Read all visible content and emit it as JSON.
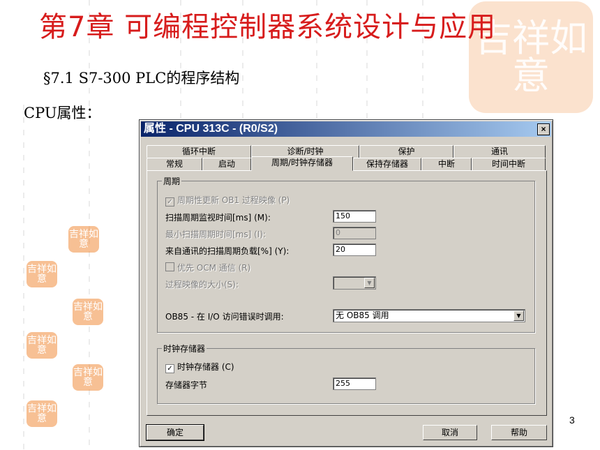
{
  "slide": {
    "title": "第7章 可编程控制器系统设计与应用",
    "section": "§7.1 S7-300 PLC的程序结构",
    "cpu_label": "CPU属性：",
    "page_number": "3",
    "seal_text_big": "吉祥如意",
    "seal_text_small": "吉祥如意"
  },
  "dialog": {
    "title": "属性 - CPU 313C - (R0/S2)",
    "close_glyph": "×",
    "tabs_row_back": [
      "循环中断",
      "诊断/时钟",
      "保护",
      "通讯"
    ],
    "tabs_row_front": [
      "常规",
      "启动",
      "周期/时钟存储器",
      "保持存储器",
      "中断",
      "时间中断"
    ],
    "active_tab": "周期/时钟存储器",
    "cycle_group": {
      "legend": "周期",
      "periodic_update_label": "周期性更新 OB1 过程映像 (P)",
      "periodic_update_checked": "✓",
      "scan_monitor_label": "扫描周期监视时间[ms] (M):",
      "scan_monitor_value": "150",
      "min_scan_label": "最小扫描周期时间[ms] (I):",
      "min_scan_value": "0",
      "comm_load_label": "来自通讯的扫描周期负载[%] (Y):",
      "comm_load_value": "20",
      "prio_ocm_label": "优先 OCM 通信 (R)",
      "process_image_label": "过程映像的大小(S):",
      "process_image_value": "",
      "ob85_label": "OB85 - 在 I/O 访问错误时调用:",
      "ob85_value": "无 OB85 调用"
    },
    "clock_group": {
      "legend": "时钟存储器",
      "clock_memory_label": "时钟存储器 (C)",
      "clock_memory_checked": "✓",
      "memory_byte_label": "存储器字节",
      "memory_byte_value": "255"
    },
    "buttons": {
      "ok": "确定",
      "cancel": "取消",
      "help": "帮助"
    }
  }
}
